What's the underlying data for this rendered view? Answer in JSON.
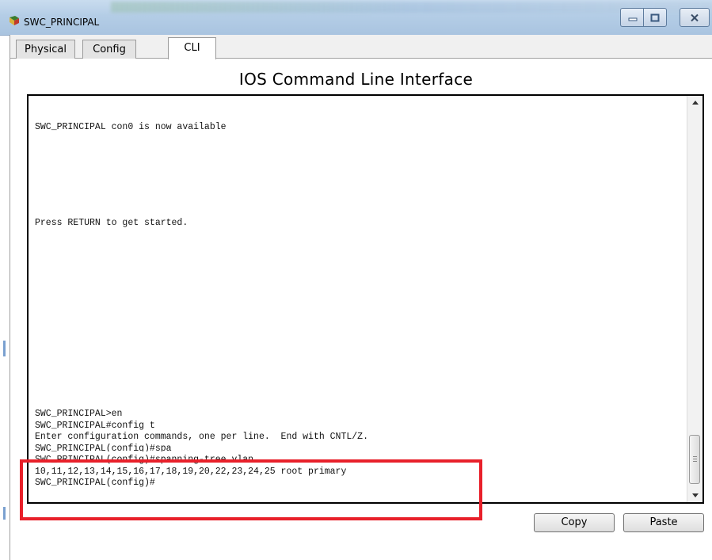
{
  "window": {
    "title": "SWC_PRINCIPAL",
    "icon": "packet-tracer-switch-icon",
    "controls": [
      "minimize-icon",
      "maximize-icon",
      "close-icon"
    ]
  },
  "tabs": [
    {
      "label": "Physical",
      "active": false
    },
    {
      "label": "Config",
      "active": false
    },
    {
      "label": "CLI",
      "active": true
    }
  ],
  "cli": {
    "heading": "IOS Command Line Interface",
    "lines": [
      "SWC_PRINCIPAL con0 is now available",
      "Press RETURN to get started.",
      "SWC_PRINCIPAL>en",
      "SWC_PRINCIPAL#config t",
      "Enter configuration commands, one per line.  End with CNTL/Z.",
      "SWC_PRINCIPAL(config)#spa",
      "SWC_PRINCIPAL(config)#spanning-tree vlan",
      "10,11,12,13,14,15,16,17,18,19,20,22,23,24,25 root primary",
      "SWC_PRINCIPAL(config)#"
    ]
  },
  "buttons": {
    "copy": "Copy",
    "paste": "Paste"
  },
  "colors": {
    "highlight_box": "#e8202a",
    "titlebar": "#b4cde6"
  }
}
